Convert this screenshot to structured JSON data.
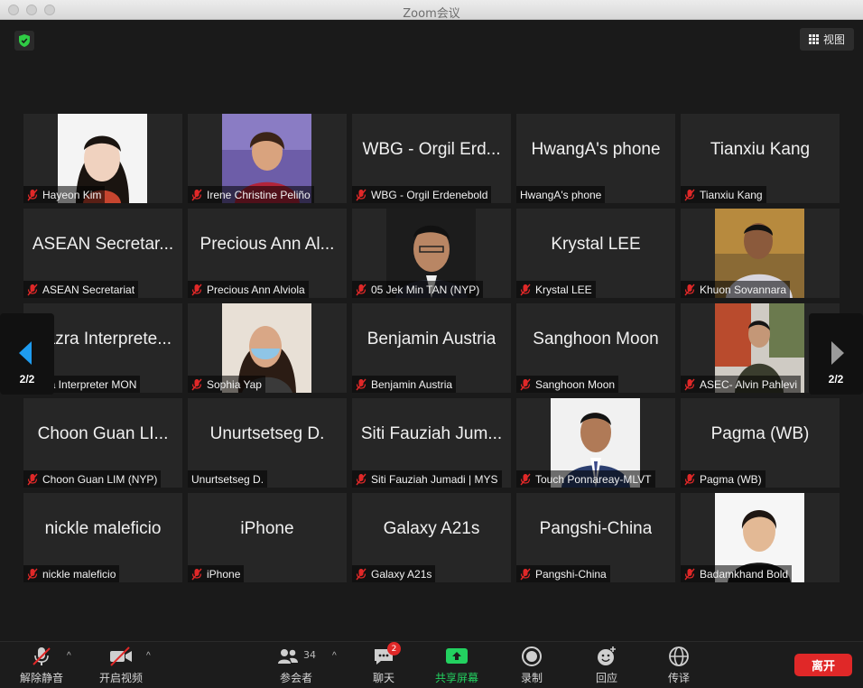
{
  "window": {
    "title": "Zoom会议"
  },
  "topbar": {
    "view_label": "视图"
  },
  "pager": {
    "page": "2/2"
  },
  "participants": [
    {
      "name": "Hayeon Kim",
      "display": "",
      "muted": true,
      "video": "photo-woman-1"
    },
    {
      "name": "Irene Christine Peliño",
      "display": "",
      "muted": true,
      "video": "photo-woman-2"
    },
    {
      "name": "WBG - Orgil Erdenebold",
      "display": "WBG - Orgil Erd...",
      "muted": true,
      "video": ""
    },
    {
      "name": "HwangA's phone",
      "display": "HwangA's phone",
      "muted": false,
      "video": ""
    },
    {
      "name": "Tianxiu Kang",
      "display": "Tianxiu Kang",
      "muted": true,
      "video": ""
    },
    {
      "name": "ASEAN Secretariat",
      "display": "ASEAN Secretar...",
      "muted": true,
      "video": ""
    },
    {
      "name": "Precious Ann Alviola",
      "display": "Precious Ann Al...",
      "muted": true,
      "video": ""
    },
    {
      "name": "05 Jek Min TAN (NYP)",
      "display": "",
      "muted": true,
      "video": "photo-man-1"
    },
    {
      "name": "Krystal LEE",
      "display": "Krystal LEE",
      "muted": true,
      "video": ""
    },
    {
      "name": "Khuon Sovannara",
      "display": "",
      "muted": true,
      "video": "photo-man-2"
    },
    {
      "name": "Bazra Interpreter MON",
      "display": "Bazra Interprete...",
      "muted": false,
      "video": ""
    },
    {
      "name": "Sophia Yap",
      "display": "",
      "muted": true,
      "video": "photo-woman-mask"
    },
    {
      "name": "Benjamin Austria",
      "display": "Benjamin Austria",
      "muted": true,
      "video": ""
    },
    {
      "name": "Sanghoon Moon",
      "display": "Sanghoon Moon",
      "muted": true,
      "video": ""
    },
    {
      "name": "ASEC- Alvin Pahlevi",
      "display": "",
      "muted": true,
      "video": "photo-man-3"
    },
    {
      "name": "Choon Guan LIM (NYP)",
      "display": "Choon Guan LI...",
      "muted": true,
      "video": ""
    },
    {
      "name": "Unurtsetseg D.",
      "display": "Unurtsetseg D.",
      "muted": false,
      "video": ""
    },
    {
      "name": "Siti Fauziah Jumadi | MYS",
      "display": "Siti Fauziah Jum...",
      "muted": true,
      "video": ""
    },
    {
      "name": "Touch Ponnareay-MLVT",
      "display": "",
      "muted": true,
      "video": "photo-man-4"
    },
    {
      "name": "Pagma (WB)",
      "display": "Pagma (WB)",
      "muted": true,
      "video": ""
    },
    {
      "name": "nickle maleficio",
      "display": "nickle maleficio",
      "muted": true,
      "video": ""
    },
    {
      "name": "iPhone",
      "display": "iPhone",
      "muted": true,
      "video": ""
    },
    {
      "name": "Galaxy A21s",
      "display": "Galaxy A21s",
      "muted": true,
      "video": ""
    },
    {
      "name": "Pangshi-China",
      "display": "Pangshi-China",
      "muted": true,
      "video": ""
    },
    {
      "name": "Badamkhand Bold",
      "display": "",
      "muted": true,
      "video": "photo-woman-3"
    }
  ],
  "toolbar": {
    "unmute": "解除静音",
    "start_video": "开启视频",
    "participants": "参会者",
    "participants_count": "34",
    "chat": "聊天",
    "chat_badge": "2",
    "share": "共享屏幕",
    "record": "录制",
    "reactions": "回应",
    "interpret": "传译",
    "leave": "离开"
  },
  "colors": {
    "share_green": "#23d160",
    "leave_red": "#e02828",
    "mute_red": "#e02828"
  }
}
